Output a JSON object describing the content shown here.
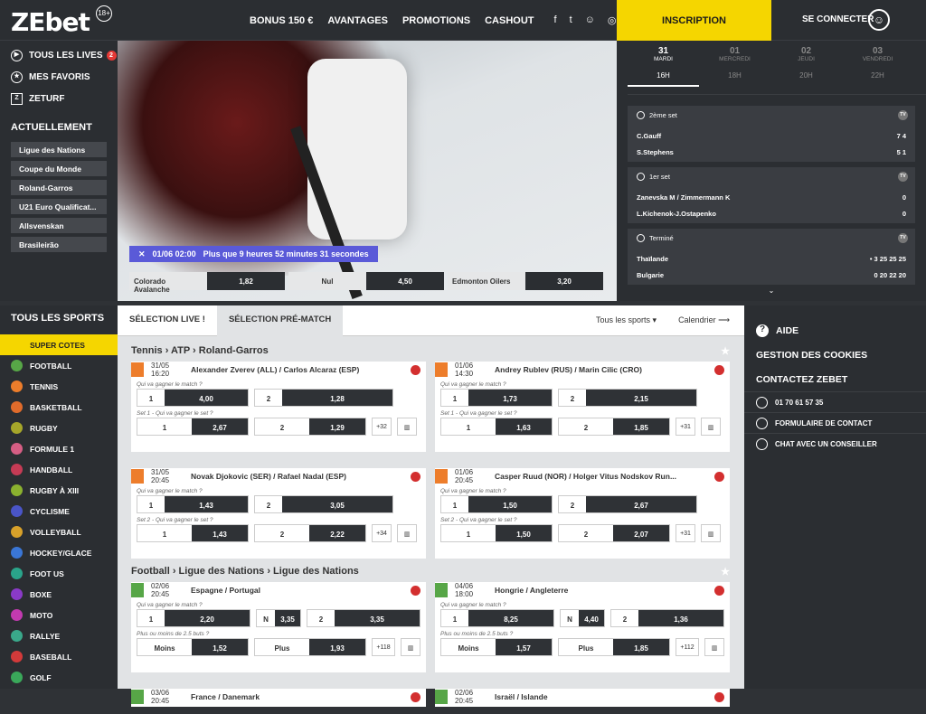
{
  "logo": {
    "ze": "ZE",
    "bet": "bet",
    "age": "18+"
  },
  "nav": [
    "BONUS 150 €",
    "AVANTAGES",
    "PROMOTIONS",
    "CASHOUT"
  ],
  "social": [
    "facebook-icon",
    "twitter-icon",
    "snapchat-icon",
    "instagram-icon"
  ],
  "inscription": "INSCRIPTION",
  "connect": "SE CONNECTER",
  "left": {
    "lives": "TOUS LES LIVES",
    "lives_count": "2",
    "favoris": "MES FAVORIS",
    "zeturf": "ZETURF",
    "actu": "ACTUELLEMENT",
    "chips": [
      "Ligue des Nations",
      "Coupe du Monde",
      "Roland-Garros",
      "U21 Euro Qualificat...",
      "Allsvenskan",
      "Brasileirão"
    ]
  },
  "hero": {
    "time": "01/06 02:00",
    "countdown": "Plus que 9 heures 52 minutes 31 secondes",
    "odds": [
      {
        "n": "Colorado Avalanche",
        "v": "1,82"
      },
      {
        "n": "Nul",
        "v": "4,50"
      },
      {
        "n": "Edmonton Oilers",
        "v": "3,20"
      }
    ]
  },
  "days": [
    {
      "d": "31",
      "w": "MARDI"
    },
    {
      "d": "01",
      "w": "MERCREDI"
    },
    {
      "d": "02",
      "w": "JEUDI"
    },
    {
      "d": "03",
      "w": "VENDREDI"
    }
  ],
  "hours": [
    "16H",
    "18H",
    "20H",
    "22H"
  ],
  "live": [
    {
      "status": "2ème set",
      "rows": [
        {
          "n": "C.Gauff",
          "s": "7   4"
        },
        {
          "n": "S.Stephens",
          "s": "5   1"
        }
      ]
    },
    {
      "status": "1er set",
      "rows": [
        {
          "n": "Zanevska M / Zimmermann K",
          "s": "0"
        },
        {
          "n": "L.Kichenok-J.Ostapenko",
          "s": "0"
        }
      ]
    },
    {
      "status": "Terminé",
      "rows": [
        {
          "n": "Thaïlande",
          "s": "•   3   25 25 25"
        },
        {
          "n": "Bulgarie",
          "s": "0   20 22 20"
        }
      ]
    }
  ],
  "sports": {
    "title": "TOUS LES SPORTS",
    "items": [
      {
        "n": "SUPER COTES",
        "c": "#f5d600"
      },
      {
        "n": "FOOTBALL",
        "c": "#57a647"
      },
      {
        "n": "TENNIS",
        "c": "#ed7d2b"
      },
      {
        "n": "BASKETBALL",
        "c": "#e06b2b"
      },
      {
        "n": "RUGBY",
        "c": "#a6a62a"
      },
      {
        "n": "FORMULE 1",
        "c": "#d65e84"
      },
      {
        "n": "HANDBALL",
        "c": "#c63b55"
      },
      {
        "n": "RUGBY À XIII",
        "c": "#8bb12f"
      },
      {
        "n": "CYCLISME",
        "c": "#4a55c8"
      },
      {
        "n": "VOLLEYBALL",
        "c": "#d8a12a"
      },
      {
        "n": "HOCKEY/GLACE",
        "c": "#3a76d6"
      },
      {
        "n": "FOOT US",
        "c": "#2aa48a"
      },
      {
        "n": "BOXE",
        "c": "#8a3ac8"
      },
      {
        "n": "MOTO",
        "c": "#c23ab0"
      },
      {
        "n": "RALLYE",
        "c": "#3aa88a"
      },
      {
        "n": "BASEBALL",
        "c": "#d33a3a"
      },
      {
        "n": "GOLF",
        "c": "#3aa85a"
      }
    ]
  },
  "tabs": {
    "live": "SÉLECTION LIVE !",
    "pre": "SÉLECTION PRÉ-MATCH",
    "all": "Tous les sports ▾",
    "cal": "Calendrier ⟶"
  },
  "s1": "Tennis › ATP › Roland-Garros",
  "s2": "Football › Ligue des Nations › Ligue des Nations",
  "cards1": [
    {
      "t": "31/05 16:20",
      "n": "Alexander Zverev (ALL) / Carlos Alcaraz (ESP)",
      "q1": "Qui va gagner le match ?",
      "a": [
        "1",
        "4,00",
        "2",
        "1,28"
      ],
      "q2": "Set 1 - Qui va gagner le set ?",
      "b": [
        "1",
        "2,67",
        "2",
        "1,29"
      ],
      "x": "+32"
    },
    {
      "t": "01/06 14:30",
      "n": "Andrey Rublev (RUS) / Marin Cilic (CRO)",
      "q1": "Qui va gagner le match ?",
      "a": [
        "1",
        "1,73",
        "2",
        "2,15"
      ],
      "q2": "Set 1 - Qui va gagner le set ?",
      "b": [
        "1",
        "1,63",
        "2",
        "1,85"
      ],
      "x": "+31"
    },
    {
      "t": "31/05 20:45",
      "n": "Novak Djokovic (SER) / Rafael Nadal (ESP)",
      "q1": "Qui va gagner le match ?",
      "a": [
        "1",
        "1,43",
        "2",
        "3,05"
      ],
      "q2": "Set 2 - Qui va gagner le set ?",
      "b": [
        "1",
        "1,43",
        "2",
        "2,22"
      ],
      "x": "+34"
    },
    {
      "t": "01/06 20:45",
      "n": "Casper Ruud (NOR) / Holger Vitus Nodskov Run...",
      "q1": "Qui va gagner le match ?",
      "a": [
        "1",
        "1,50",
        "2",
        "2,67"
      ],
      "q2": "Set 2 - Qui va gagner le set ?",
      "b": [
        "1",
        "1,50",
        "2",
        "2,07"
      ],
      "x": "+31"
    }
  ],
  "cards2": [
    {
      "t": "02/06 20:45",
      "n": "Espagne / Portugal",
      "q1": "Qui va gagner le match ?",
      "a": [
        "1",
        "2,20",
        "N",
        "3,35",
        "2",
        "3,35"
      ],
      "q2": "Plus ou moins de 2.5 buts ?",
      "b": [
        "Moins",
        "1,52",
        "Plus",
        "1,93"
      ],
      "x": "+118"
    },
    {
      "t": "04/06 18:00",
      "n": "Hongrie / Angleterre",
      "q1": "Qui va gagner le match ?",
      "a": [
        "1",
        "8,25",
        "N",
        "4,40",
        "2",
        "1,36"
      ],
      "q2": "Plus ou moins de 2.5 buts ?",
      "b": [
        "Moins",
        "1,57",
        "Plus",
        "1,85"
      ],
      "x": "+112"
    },
    {
      "t": "03/06 20:45",
      "n": "France / Danemark"
    },
    {
      "t": "02/06 20:45",
      "n": "Israël / Islande"
    }
  ],
  "right": {
    "aide": "AIDE",
    "cookies": "GESTION DES COOKIES",
    "contact": "CONTACTEZ ZEBET",
    "phone": "01 70 61 57 35",
    "form": "FORMULAIRE DE CONTACT",
    "chat": "CHAT AVEC UN CONSEILLER"
  }
}
